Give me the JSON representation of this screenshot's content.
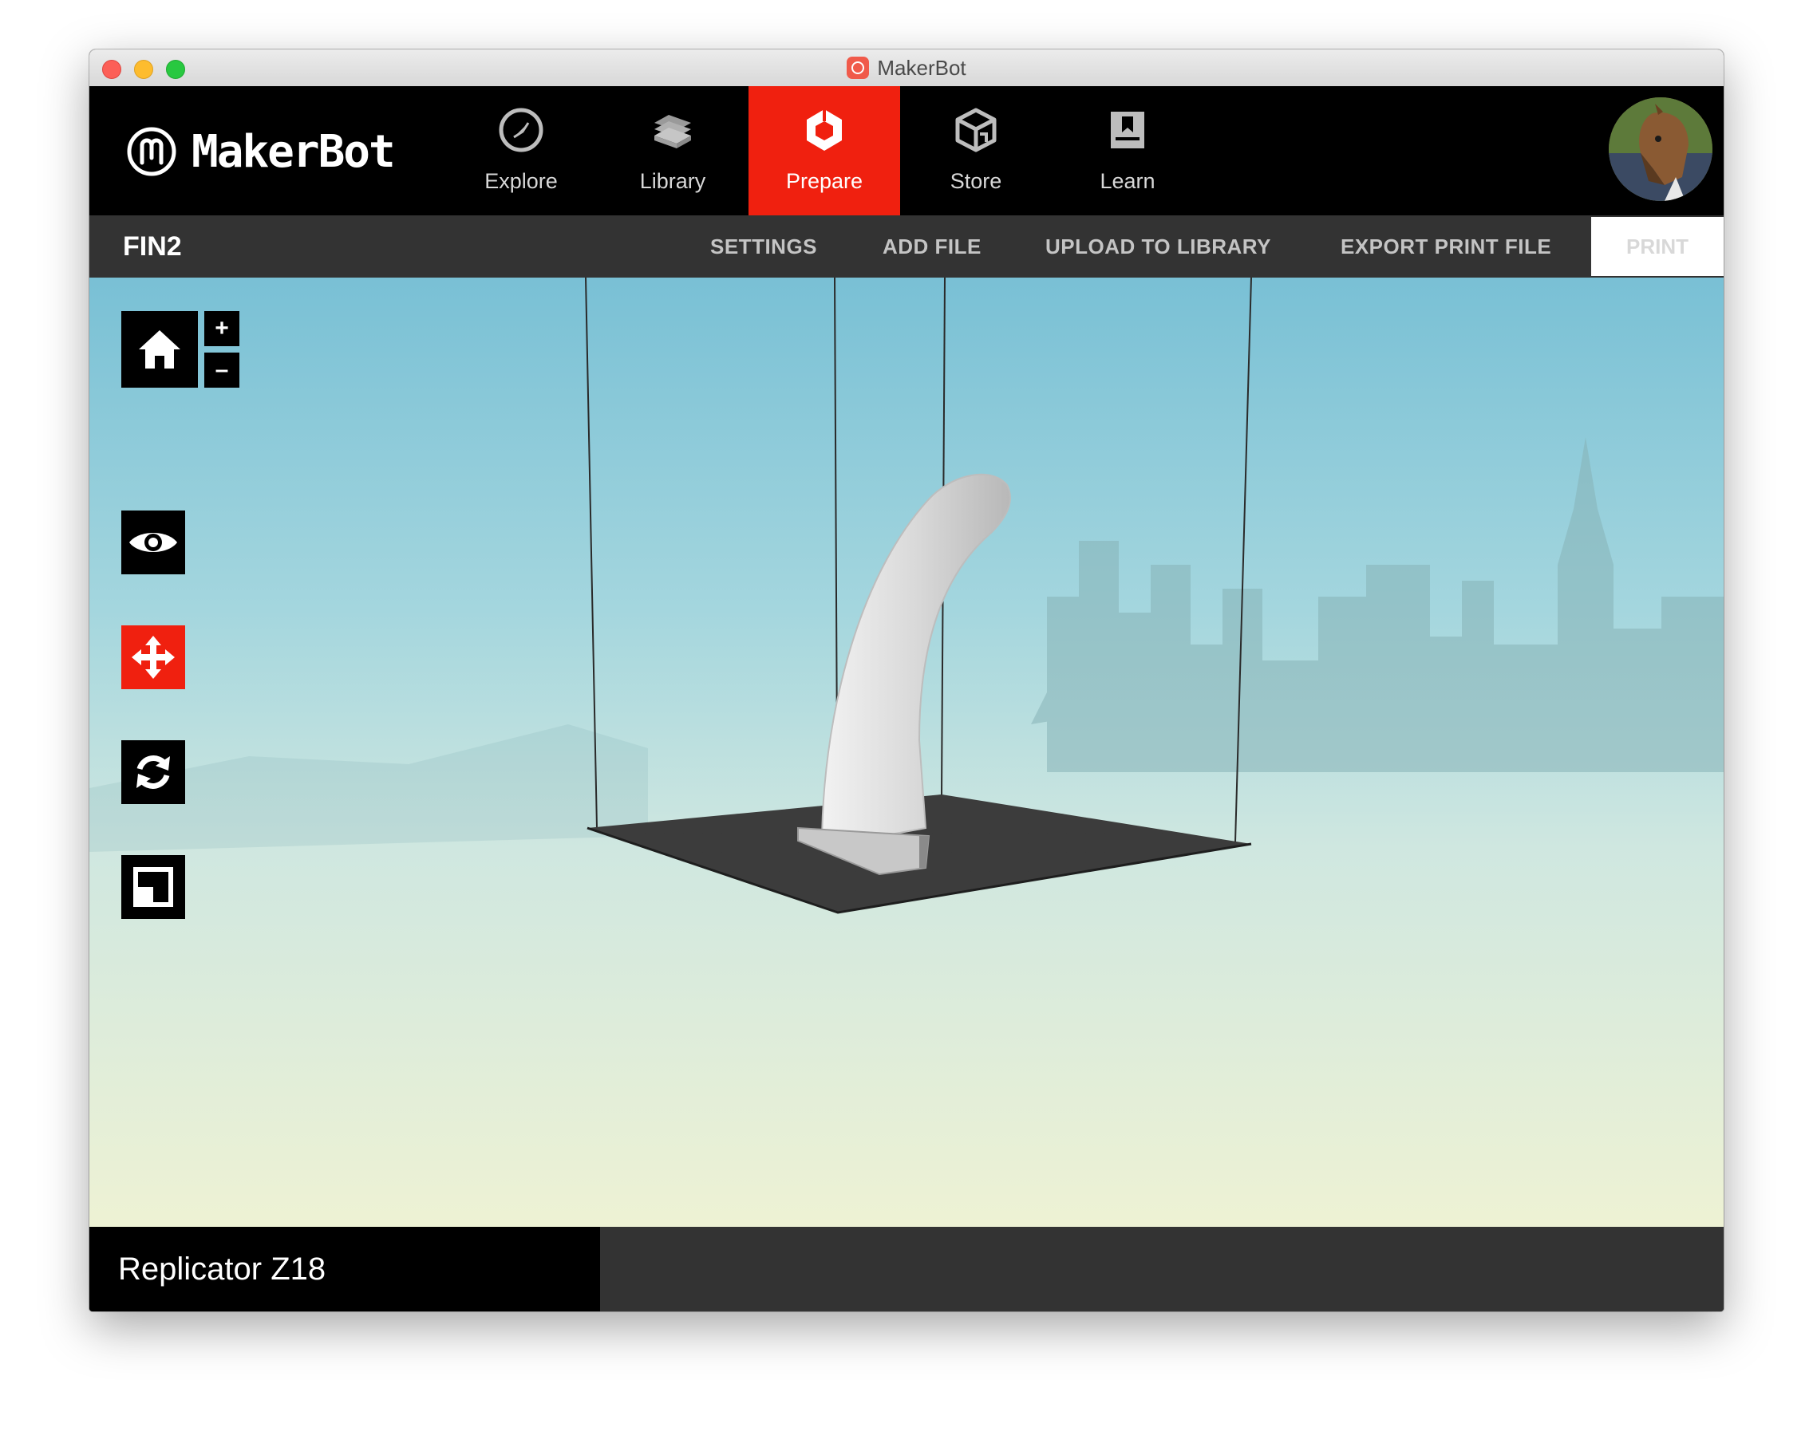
{
  "window": {
    "title": "MakerBot"
  },
  "brand": {
    "logo_text": "MakerBot",
    "accent_color": "#f0200f"
  },
  "nav": {
    "tabs": [
      {
        "label": "Explore",
        "icon": "compass-icon"
      },
      {
        "label": "Library",
        "icon": "library-stack-icon"
      },
      {
        "label": "Prepare",
        "icon": "prepare-hexagon-icon",
        "active": true
      },
      {
        "label": "Store",
        "icon": "cube-icon"
      },
      {
        "label": "Learn",
        "icon": "book-icon"
      }
    ],
    "avatar": "user-avatar"
  },
  "toolbar": {
    "project_name": "FIN2",
    "settings": "SETTINGS",
    "add_file": "ADD FILE",
    "upload": "UPLOAD TO LIBRARY",
    "export": "EXPORT PRINT FILE",
    "print": "PRINT"
  },
  "viewport": {
    "home": "home-icon",
    "zoom_in": "+",
    "zoom_out": "–",
    "tools": [
      {
        "name": "view",
        "icon": "eye-icon"
      },
      {
        "name": "move",
        "icon": "move-arrows-icon",
        "active": true
      },
      {
        "name": "rotate",
        "icon": "rotate-icon"
      },
      {
        "name": "scale",
        "icon": "scale-icon"
      }
    ]
  },
  "status": {
    "printer": "Replicator Z18"
  }
}
